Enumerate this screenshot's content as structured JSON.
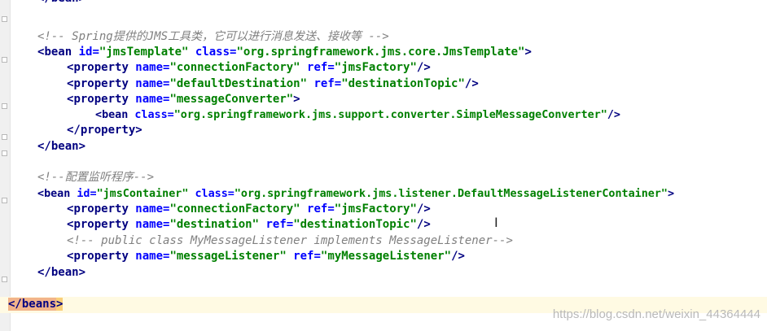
{
  "lines": {
    "l1": {
      "open": "</",
      "tag": "bean",
      "close": ">"
    },
    "l2": {
      "comment": "<!-- Spring提供的JMS工具类，它可以进行消息发送、接收等 -->"
    },
    "l3": {
      "open": "<",
      "tag": "bean",
      "a1": " id=",
      "v1": "\"jmsTemplate\"",
      "a2": " class=",
      "v2": "\"org.springframework.jms.core.JmsTemplate\"",
      "close": ">"
    },
    "l4": {
      "open": "<",
      "tag": "property",
      "a1": " name=",
      "v1": "\"connectionFactory\"",
      "a2": " ref=",
      "v2": "\"jmsFactory\"",
      "close": "/>"
    },
    "l5": {
      "open": "<",
      "tag": "property",
      "a1": " name=",
      "v1": "\"defaultDestination\"",
      "a2": " ref=",
      "v2": "\"destinationTopic\"",
      "close": "/>"
    },
    "l6": {
      "open": "<",
      "tag": "property",
      "a1": " name=",
      "v1": "\"messageConverter\"",
      "close": ">"
    },
    "l7": {
      "open": "<",
      "tag": "bean",
      "a1": " class=",
      "v1": "\"org.springframework.jms.support.converter.SimpleMessageConverter\"",
      "close": "/>"
    },
    "l8": {
      "open": "</",
      "tag": "property",
      "close": ">"
    },
    "l9": {
      "open": "</",
      "tag": "bean",
      "close": ">"
    },
    "l10": {
      "comment": "<!--配置监听程序-->"
    },
    "l11": {
      "open": "<",
      "tag": "bean",
      "a1": " id=",
      "v1": "\"jmsContainer\"",
      "a2": " class=",
      "v2": "\"org.springframework.jms.listener.DefaultMessageListenerContainer\"",
      "close": ">"
    },
    "l12": {
      "open": "<",
      "tag": "property",
      "a1": " name=",
      "v1": "\"connectionFactory\"",
      "a2": " ref=",
      "v2": "\"jmsFactory\"",
      "close": "/>"
    },
    "l13": {
      "open": "<",
      "tag": "property",
      "a1": " name=",
      "v1": "\"destination\"",
      "a2": " ref=",
      "v2": "\"destinationTopic\"",
      "close": "/>"
    },
    "l14": {
      "comment": "<!-- public class MyMessageListener implements MessageListener-->"
    },
    "l15": {
      "open": "<",
      "tag": "property",
      "a1": " name=",
      "v1": "\"messageListener\"",
      "a2": " ref=",
      "v2": "\"myMessageListener\"",
      "close": "/>"
    },
    "l16": {
      "open": "</",
      "tag": "bean",
      "close": ">"
    },
    "l17": {
      "tag": "</beans",
      "close": ">"
    }
  },
  "watermark": "https://blog.csdn.net/weixin_44364444",
  "colors": {
    "tag": "#000080",
    "attribute": "#0000ff",
    "value": "#008000",
    "comment": "#808080",
    "current_line": "#fffae3",
    "matched_tag_highlight": "#f2b48a"
  }
}
